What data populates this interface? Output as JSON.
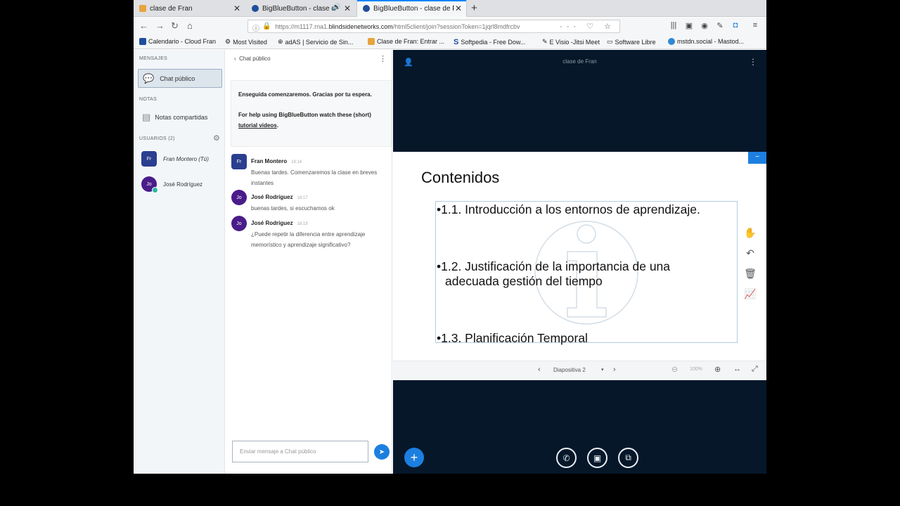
{
  "browser": {
    "tabs": [
      {
        "title": "clase de Fran",
        "favicon_color": "#e8a33d"
      },
      {
        "title": "BigBlueButton - clase d",
        "favicon_color": "#1f4e9c"
      },
      {
        "title": "BigBlueButton - clase de F",
        "favicon_color": "#1f4e9c"
      }
    ],
    "url_prefix": "https://m1117.rna1.",
    "url_domain": "blindsidenetworks.com",
    "url_suffix": "/html5client/join?sessionToken=1jqrl8mdfrcbv",
    "bookmarks": [
      {
        "label": "Calendario - Cloud Fran",
        "color": "#1f4e9c"
      },
      {
        "label": "Most Visited",
        "color": "#666666"
      },
      {
        "label": "adAS | Servicio de Sin...",
        "color": "#555555"
      },
      {
        "label": "Clase de Fran: Entrar ...",
        "color": "#e8a33d"
      },
      {
        "label": "Softpedia - Free Dow...",
        "color": "#1f4e9c"
      },
      {
        "label": "E Visio -Jitsi Meet",
        "color": "#777777"
      },
      {
        "label": "Software Libre",
        "color": "#888888"
      },
      {
        "label": "mstdn.social - Mastod...",
        "color": "#3088d4"
      }
    ]
  },
  "sidebar": {
    "messages_header": "MENSAJES",
    "public_chat": "Chat público",
    "notes_header": "NOTAS",
    "shared_notes": "Notas compartidas",
    "users_header": "USUARIOS (2)",
    "users": [
      {
        "initials": "Fr",
        "name": "Fran Montero (Tú)",
        "color": "#2a3f8f"
      },
      {
        "initials": "Jo",
        "name": "José Rodríguez",
        "color": "#4a1c8a"
      }
    ]
  },
  "chat": {
    "title": "Chat público",
    "welcome_line1": "Enseguida comenzaremos. Gracias por tu espera.",
    "welcome_line2": "For help using BigBlueButton watch these (short)",
    "welcome_link": "tutorial videos",
    "welcome_end": ".",
    "messages": [
      {
        "initials": "Fr",
        "name": "Fran Montero",
        "time": "18:14",
        "text": "Buenas tardes. Comenzaremos la clase en breves instantes",
        "color": "#2a3f8f"
      },
      {
        "initials": "Jo",
        "name": "José Rodríguez",
        "time": "18:17",
        "text": "buenas tardes, si escuchamos ok",
        "color": "#4a1c8a"
      },
      {
        "initials": "Jo",
        "name": "José Rodríguez",
        "time": "18:19",
        "text": "¿Puede repetir la diferencia entre aprendizaje memorístico y aprendizaje significativo?",
        "color": "#4a1c8a"
      }
    ],
    "input_placeholder": "Enviar mensaje a Chat público"
  },
  "main": {
    "title": "clase de Fran",
    "slide": {
      "title": "Contenidos",
      "bullets": [
        "•1.1. Introducción a los entornos de aprendizaje.",
        "•1.2. Justificación de la importancia de una",
        "adecuada gestión del tiempo",
        "•1.3. Planificación Temporal"
      ]
    },
    "slide_selector": "Diapositiva 2",
    "zoom": "100%"
  },
  "colors": {
    "accent": "#1c7fe0",
    "main_bg": "#06172a"
  }
}
